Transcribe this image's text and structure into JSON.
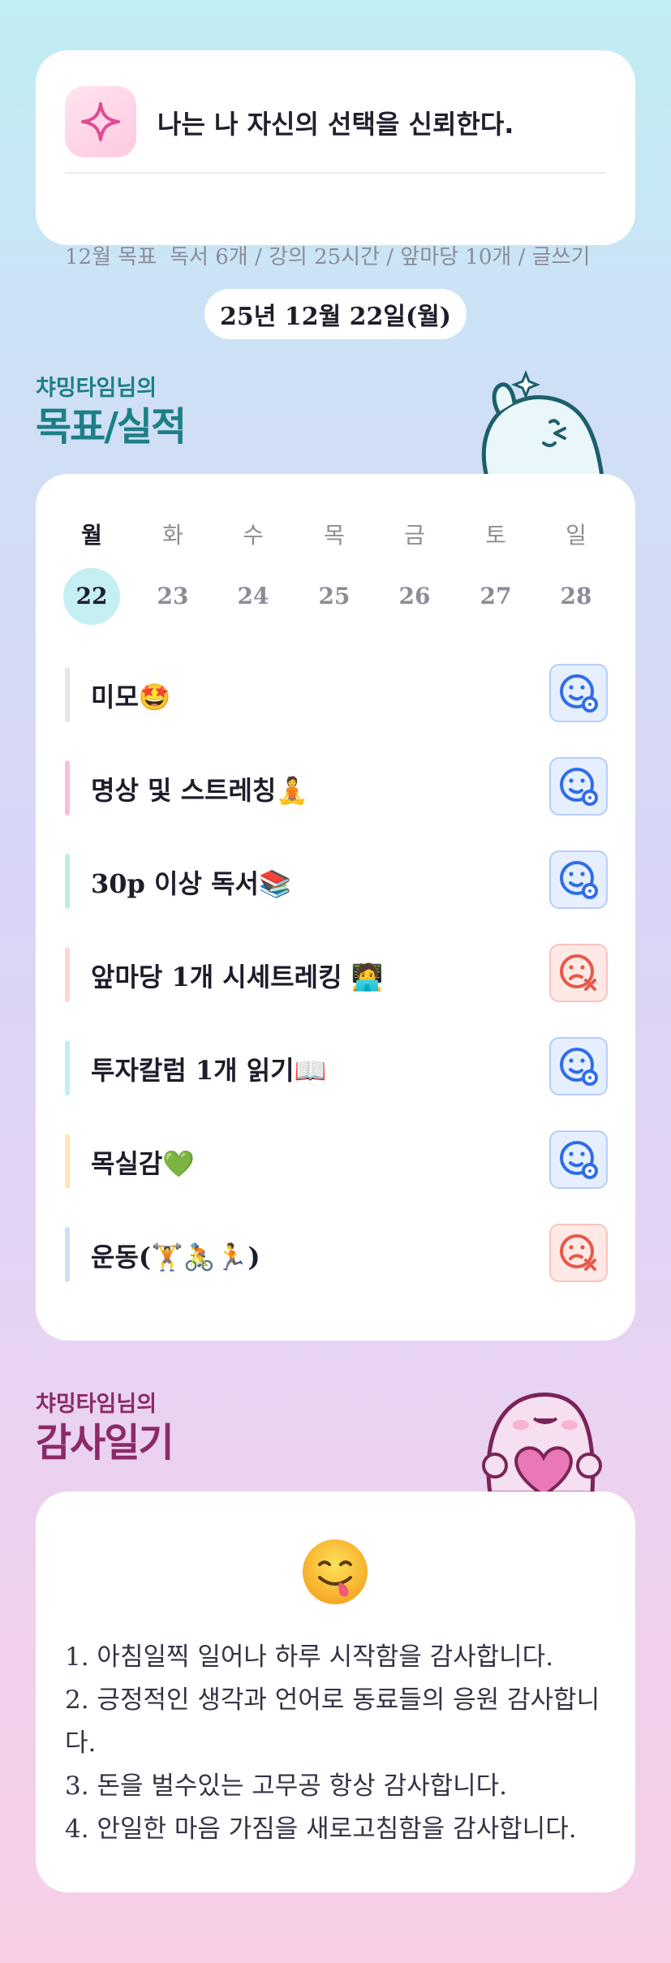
{
  "header": {
    "motto": "나는 나 자신의 선택을 신뢰한다.",
    "goal_label": "12월 목표",
    "goal_text": "독서 6개 / 강의 25시간 / 앞마당 10개 / 글쓰기"
  },
  "date": "25년 12월 22일(월)",
  "goals_section": {
    "subtitle": "챠밍타임님의",
    "title": "목표/실적"
  },
  "week": {
    "days": [
      "월",
      "화",
      "수",
      "목",
      "금",
      "토",
      "일"
    ],
    "dates": [
      "22",
      "23",
      "24",
      "25",
      "26",
      "27",
      "28"
    ],
    "active_index": 0
  },
  "goals": [
    {
      "label": "미모🤩",
      "status": "done",
      "bar_color": "#e6e6ea"
    },
    {
      "label": "명상 및 스트레칭🧘",
      "status": "done",
      "bar_color": "#f7bfdb"
    },
    {
      "label": "30p 이상 독서📚",
      "status": "done",
      "bar_color": "#bfeedd"
    },
    {
      "label": "앞마당 1개 시세트레킹 🧑‍💻",
      "status": "fail",
      "bar_color": "#fbd7d1"
    },
    {
      "label": "투자칼럼 1개 읽기📖",
      "status": "done",
      "bar_color": "#c3eef3"
    },
    {
      "label": "목실감💚",
      "status": "done",
      "bar_color": "#fde5bd"
    },
    {
      "label": "운동(🏋️🚴🏃)",
      "status": "fail",
      "bar_color": "#cfdff7"
    }
  ],
  "gratitude_section": {
    "subtitle": "챠밍타임님의",
    "title": "감사일기"
  },
  "gratitude": {
    "lines": [
      "1. 아침일찍 일어나 하루 시작함을 감사합니다.",
      "2. 긍정적인 생각과 언어로 동료들의 응원 감사합니다.",
      "3. 돈을 벌수있는 고무공 항상 감사합니다.",
      "4. 안일한 마음 가짐을 새로고침함을 감사합니다."
    ]
  },
  "colors": {
    "teal": "#1d7f86",
    "plum": "#8c2a68",
    "ok_blue": "#2f6de8",
    "fail_red": "#e8584a"
  },
  "icons": [
    "sparkle-icon",
    "smile-check-icon",
    "sad-x-icon",
    "ghost-mascot-icon",
    "heart-mascot-icon",
    "yum-face-icon"
  ]
}
